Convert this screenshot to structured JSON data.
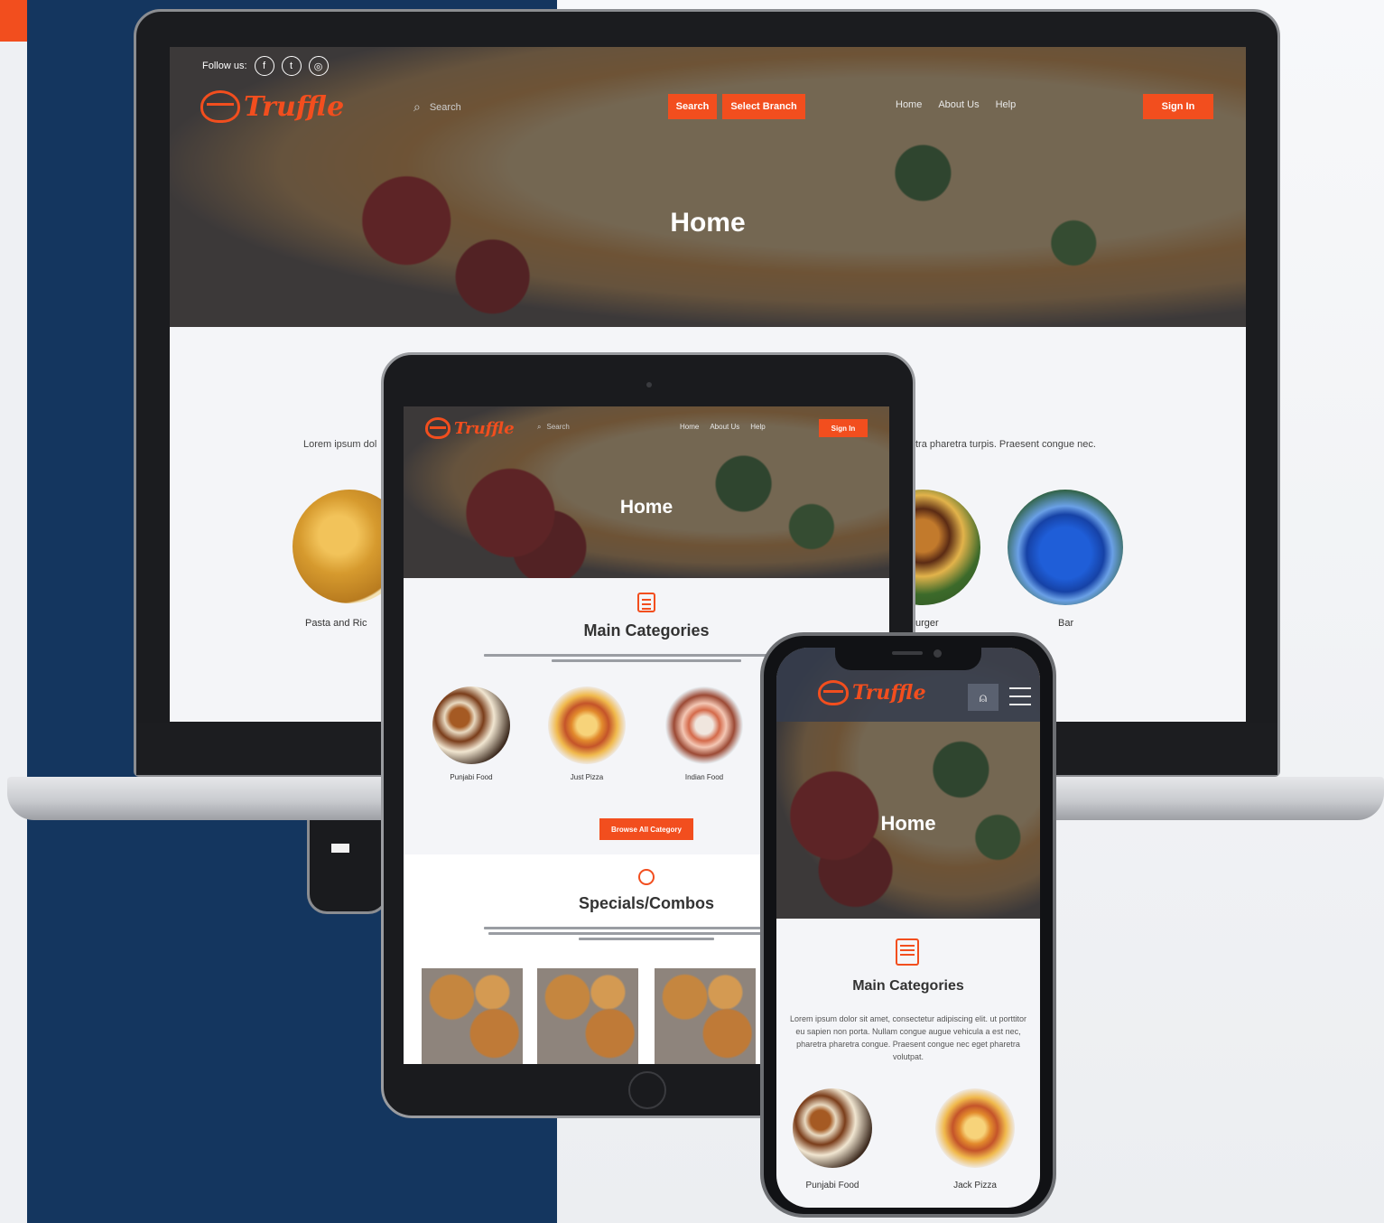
{
  "laptop": {
    "follow_label": "Follow us:",
    "social": [
      {
        "icon": "facebook-icon",
        "glyph": "f"
      },
      {
        "icon": "twitter-icon",
        "glyph": "t"
      },
      {
        "icon": "instagram-icon",
        "glyph": "◎"
      }
    ],
    "logo_text": "Truffle",
    "search_placeholder": "Search",
    "buttons": {
      "search": "Search",
      "select_branch": "Select Branch",
      "sign_in": "Sign In"
    },
    "nav": [
      "Home",
      "About Us",
      "Help"
    ],
    "hero_title": "Home",
    "desc_left": "Lorem ipsum dol",
    "desc_right": "tra pharetra turpis. Praesent congue nec.",
    "categories": [
      {
        "label": "Pasta and Ric",
        "icon": "pasta-image"
      },
      {
        "label": "urger",
        "icon": "burger-image"
      },
      {
        "label": "Bar",
        "icon": "bar-drink-image"
      }
    ]
  },
  "tablet": {
    "logo_text": "Truffle",
    "search_placeholder": "Search",
    "nav": [
      "Home",
      "About Us",
      "Help"
    ],
    "sign_in": "Sign In",
    "hero_title": "Home",
    "main_categories_title": "Main Categories",
    "categories": [
      {
        "label": "Punjabi Food",
        "icon": "thali-image"
      },
      {
        "label": "Just Pizza",
        "icon": "pizza-image"
      },
      {
        "label": "Indian Food",
        "icon": "indian-food-image"
      }
    ],
    "browse_button": "Browse All Category",
    "specials_title": "Specials/Combos"
  },
  "phone": {
    "logo_text": "Truffle",
    "hero_title": "Home",
    "main_categories_title": "Main Categories",
    "description": "Lorem ipsum dolor sit amet, consectetur adipiscing elit. ut porttitor eu sapien non porta. Nullam congue augue vehicula a est nec, pharetra pharetra congue. Praesent congue nec eget pharetra volutpat.",
    "categories": [
      {
        "label": "Punjabi Food",
        "icon": "thali-image"
      },
      {
        "label": "Jack Pizza",
        "icon": "pizza-image"
      }
    ]
  },
  "colors": {
    "accent": "#f24e1e",
    "navy": "#14365f"
  }
}
